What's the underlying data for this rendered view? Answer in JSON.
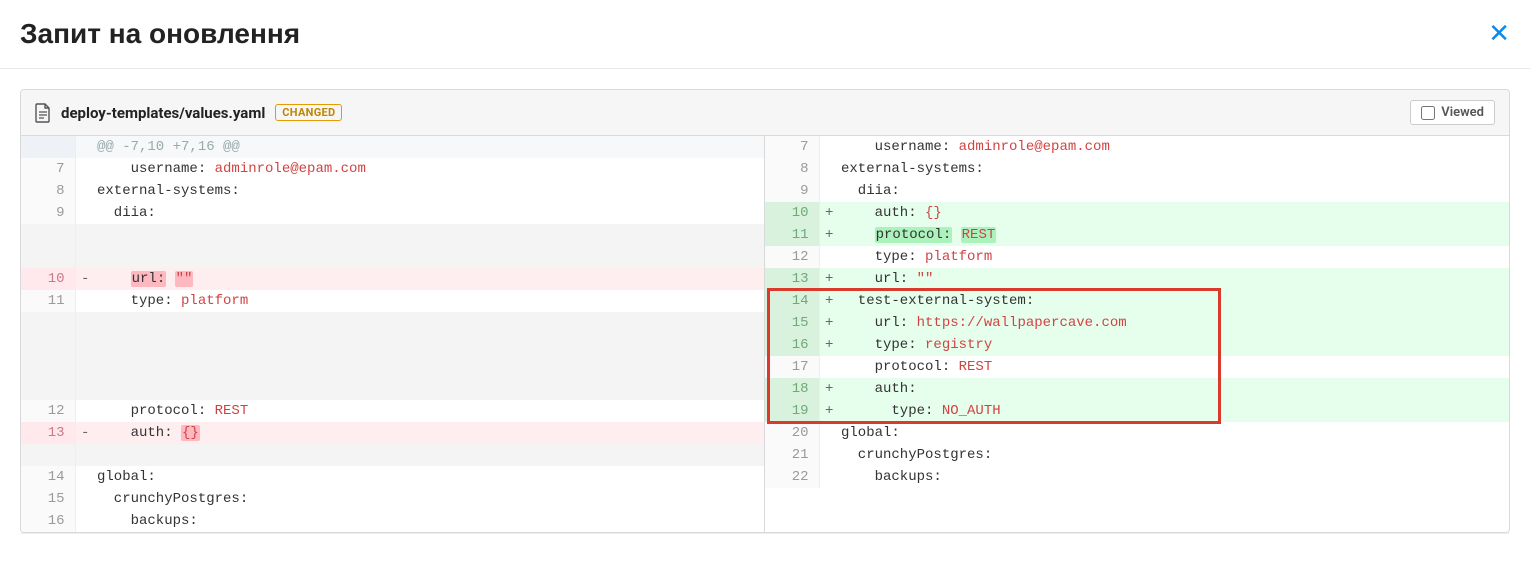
{
  "header": {
    "title": "Запит на оновлення"
  },
  "file": {
    "name": "deploy-templates/values.yaml",
    "badge": "CHANGED",
    "viewed_label": "Viewed"
  },
  "hunk_header": "@@ -7,10 +7,16 @@",
  "left": [
    {
      "num": "",
      "sign": "",
      "type": "hunk",
      "tokens": [
        {
          "t": "@@ -7,10 +7,16 @@",
          "cls": ""
        }
      ]
    },
    {
      "num": "7",
      "sign": "",
      "type": "ctx",
      "tokens": [
        {
          "t": "    username: ",
          "cls": "tk-key"
        },
        {
          "t": "adminrole@epam.com",
          "cls": "tk-val"
        }
      ]
    },
    {
      "num": "8",
      "sign": "",
      "type": "ctx",
      "tokens": [
        {
          "t": "external-systems:",
          "cls": "tk-key"
        }
      ]
    },
    {
      "num": "9",
      "sign": "",
      "type": "ctx",
      "tokens": [
        {
          "t": "  diia:",
          "cls": "tk-key"
        }
      ]
    },
    {
      "num": "",
      "sign": "",
      "type": "empty",
      "tokens": []
    },
    {
      "num": "",
      "sign": "",
      "type": "empty",
      "tokens": []
    },
    {
      "num": "10",
      "sign": "-",
      "type": "del",
      "tokens": [
        {
          "t": "    ",
          "cls": ""
        },
        {
          "t": "url:",
          "cls": "tk-key hl-del"
        },
        {
          "t": " ",
          "cls": ""
        },
        {
          "t": "\"\"",
          "cls": "tk-val hl-del"
        }
      ]
    },
    {
      "num": "11",
      "sign": "",
      "type": "ctx",
      "tokens": [
        {
          "t": "    type: ",
          "cls": "tk-key"
        },
        {
          "t": "platform",
          "cls": "tk-val"
        }
      ]
    },
    {
      "num": "",
      "sign": "",
      "type": "empty",
      "tokens": []
    },
    {
      "num": "",
      "sign": "",
      "type": "empty",
      "tokens": []
    },
    {
      "num": "",
      "sign": "",
      "type": "empty",
      "tokens": []
    },
    {
      "num": "",
      "sign": "",
      "type": "empty",
      "tokens": []
    },
    {
      "num": "12",
      "sign": "",
      "type": "ctx",
      "tokens": [
        {
          "t": "    protocol: ",
          "cls": "tk-key"
        },
        {
          "t": "REST",
          "cls": "tk-val"
        }
      ]
    },
    {
      "num": "13",
      "sign": "-",
      "type": "del",
      "tokens": [
        {
          "t": "    auth: ",
          "cls": "tk-key"
        },
        {
          "t": "{}",
          "cls": "tk-val hl-del"
        }
      ]
    },
    {
      "num": "",
      "sign": "",
      "type": "empty",
      "tokens": []
    },
    {
      "num": "14",
      "sign": "",
      "type": "ctx",
      "tokens": [
        {
          "t": "global:",
          "cls": "tk-key"
        }
      ]
    },
    {
      "num": "15",
      "sign": "",
      "type": "ctx",
      "tokens": [
        {
          "t": "  crunchyPostgres:",
          "cls": "tk-key"
        }
      ]
    },
    {
      "num": "16",
      "sign": "",
      "type": "ctx",
      "tokens": [
        {
          "t": "    backups:",
          "cls": "tk-key"
        }
      ]
    }
  ],
  "right": [
    {
      "num": "7",
      "sign": "",
      "type": "ctx",
      "box": false,
      "tokens": [
        {
          "t": "    username: ",
          "cls": "tk-key"
        },
        {
          "t": "adminrole@epam.com",
          "cls": "tk-val"
        }
      ]
    },
    {
      "num": "8",
      "sign": "",
      "type": "ctx",
      "box": false,
      "tokens": [
        {
          "t": "external-systems:",
          "cls": "tk-key"
        }
      ]
    },
    {
      "num": "9",
      "sign": "",
      "type": "ctx",
      "box": false,
      "tokens": [
        {
          "t": "  diia:",
          "cls": "tk-key"
        }
      ]
    },
    {
      "num": "10",
      "sign": "+",
      "type": "add",
      "box": false,
      "tokens": [
        {
          "t": "    auth: ",
          "cls": "tk-key"
        },
        {
          "t": "{}",
          "cls": "tk-val"
        }
      ]
    },
    {
      "num": "11",
      "sign": "+",
      "type": "add",
      "box": false,
      "tokens": [
        {
          "t": "    ",
          "cls": ""
        },
        {
          "t": "protocol:",
          "cls": "tk-key hl-add"
        },
        {
          "t": " ",
          "cls": ""
        },
        {
          "t": "REST",
          "cls": "tk-val hl-add"
        }
      ]
    },
    {
      "num": "12",
      "sign": "",
      "type": "ctx",
      "box": false,
      "tokens": [
        {
          "t": "    type: ",
          "cls": "tk-key"
        },
        {
          "t": "platform",
          "cls": "tk-val"
        }
      ]
    },
    {
      "num": "13",
      "sign": "+",
      "type": "add",
      "box": false,
      "tokens": [
        {
          "t": "    url: ",
          "cls": "tk-key"
        },
        {
          "t": "\"\"",
          "cls": "tk-val"
        }
      ]
    },
    {
      "num": "14",
      "sign": "+",
      "type": "add",
      "box": true,
      "tokens": [
        {
          "t": "  test-external-system:",
          "cls": "tk-key"
        }
      ]
    },
    {
      "num": "15",
      "sign": "+",
      "type": "add",
      "box": true,
      "tokens": [
        {
          "t": "    url: ",
          "cls": "tk-key"
        },
        {
          "t": "https://wallpapercave.com",
          "cls": "tk-val"
        }
      ]
    },
    {
      "num": "16",
      "sign": "+",
      "type": "add",
      "box": true,
      "tokens": [
        {
          "t": "    type: ",
          "cls": "tk-key"
        },
        {
          "t": "registry",
          "cls": "tk-val"
        }
      ]
    },
    {
      "num": "17",
      "sign": "",
      "type": "ctx",
      "box": true,
      "tokens": [
        {
          "t": "    protocol: ",
          "cls": "tk-key"
        },
        {
          "t": "REST",
          "cls": "tk-val"
        }
      ]
    },
    {
      "num": "18",
      "sign": "+",
      "type": "add",
      "box": true,
      "tokens": [
        {
          "t": "    auth:",
          "cls": "tk-key"
        }
      ]
    },
    {
      "num": "19",
      "sign": "+",
      "type": "add",
      "box": true,
      "tokens": [
        {
          "t": "      type: ",
          "cls": "tk-key"
        },
        {
          "t": "NO_AUTH",
          "cls": "tk-val"
        }
      ]
    },
    {
      "num": "20",
      "sign": "",
      "type": "ctx",
      "box": false,
      "tokens": [
        {
          "t": "global:",
          "cls": "tk-key"
        }
      ]
    },
    {
      "num": "21",
      "sign": "",
      "type": "ctx",
      "box": false,
      "tokens": [
        {
          "t": "  crunchyPostgres:",
          "cls": "tk-key"
        }
      ]
    },
    {
      "num": "22",
      "sign": "",
      "type": "ctx",
      "box": false,
      "tokens": [
        {
          "t": "    backups:",
          "cls": "tk-key"
        }
      ]
    }
  ]
}
